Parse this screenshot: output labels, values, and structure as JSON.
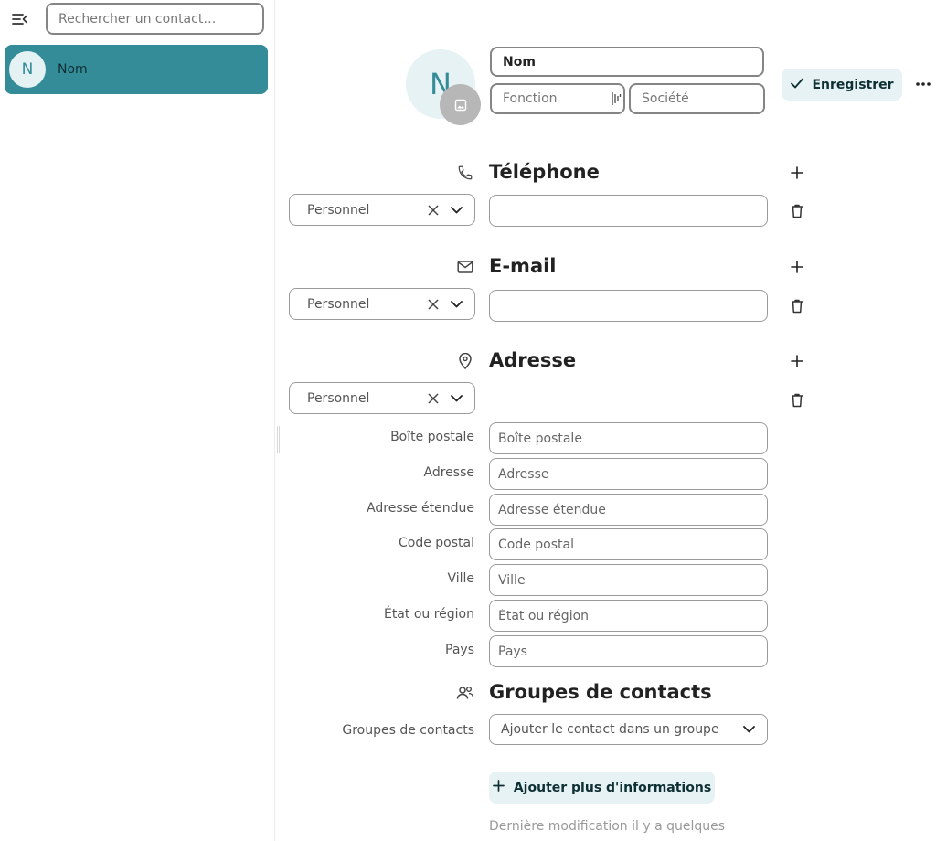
{
  "sidebar": {
    "toggle_icon": "menu-collapse-icon",
    "search": {
      "placeholder": "Rechercher un contact…",
      "value": ""
    },
    "contacts": [
      {
        "initial": "N",
        "name": "Nom",
        "selected": true
      }
    ],
    "accent_color": "#348c98"
  },
  "header": {
    "avatar_initial": "N",
    "avatar_edit_icon": "image-icon",
    "name": {
      "placeholder": "Nom",
      "value": ""
    },
    "role": {
      "placeholder": "Fonction",
      "value": ""
    },
    "company": {
      "placeholder": "Société",
      "value": ""
    },
    "save_label": "Enregistrer",
    "more_icon": "more-horizontal-icon"
  },
  "phone": {
    "icon": "phone-icon",
    "title": "Téléphone",
    "entries": [
      {
        "type": "Personnel",
        "value": ""
      }
    ]
  },
  "email": {
    "icon": "mail-icon",
    "title": "E-mail",
    "entries": [
      {
        "type": "Personnel",
        "value": ""
      }
    ]
  },
  "address": {
    "icon": "map-marker-icon",
    "title": "Adresse",
    "type": "Personnel",
    "fields": {
      "po_box": {
        "label": "Boîte postale",
        "placeholder": "Boîte postale",
        "value": ""
      },
      "street": {
        "label": "Adresse",
        "placeholder": "Adresse",
        "value": ""
      },
      "extended": {
        "label": "Adresse étendue",
        "placeholder": "Adresse étendue",
        "value": ""
      },
      "postal_code": {
        "label": "Code postal",
        "placeholder": "Code postal",
        "value": ""
      },
      "city": {
        "label": "Ville",
        "placeholder": "Ville",
        "value": ""
      },
      "region": {
        "label": "État ou région",
        "placeholder": "État ou région",
        "value": ""
      },
      "country": {
        "label": "Pays",
        "placeholder": "Pays",
        "value": ""
      }
    }
  },
  "groups": {
    "icon": "account-group-icon",
    "title": "Groupes de contacts",
    "label": "Groupes de contacts",
    "select_placeholder": "Ajouter le contact dans un groupe"
  },
  "footer": {
    "add_more_label": "Ajouter plus d'informations",
    "last_modified": "Dernière modification il y a quelques"
  }
}
